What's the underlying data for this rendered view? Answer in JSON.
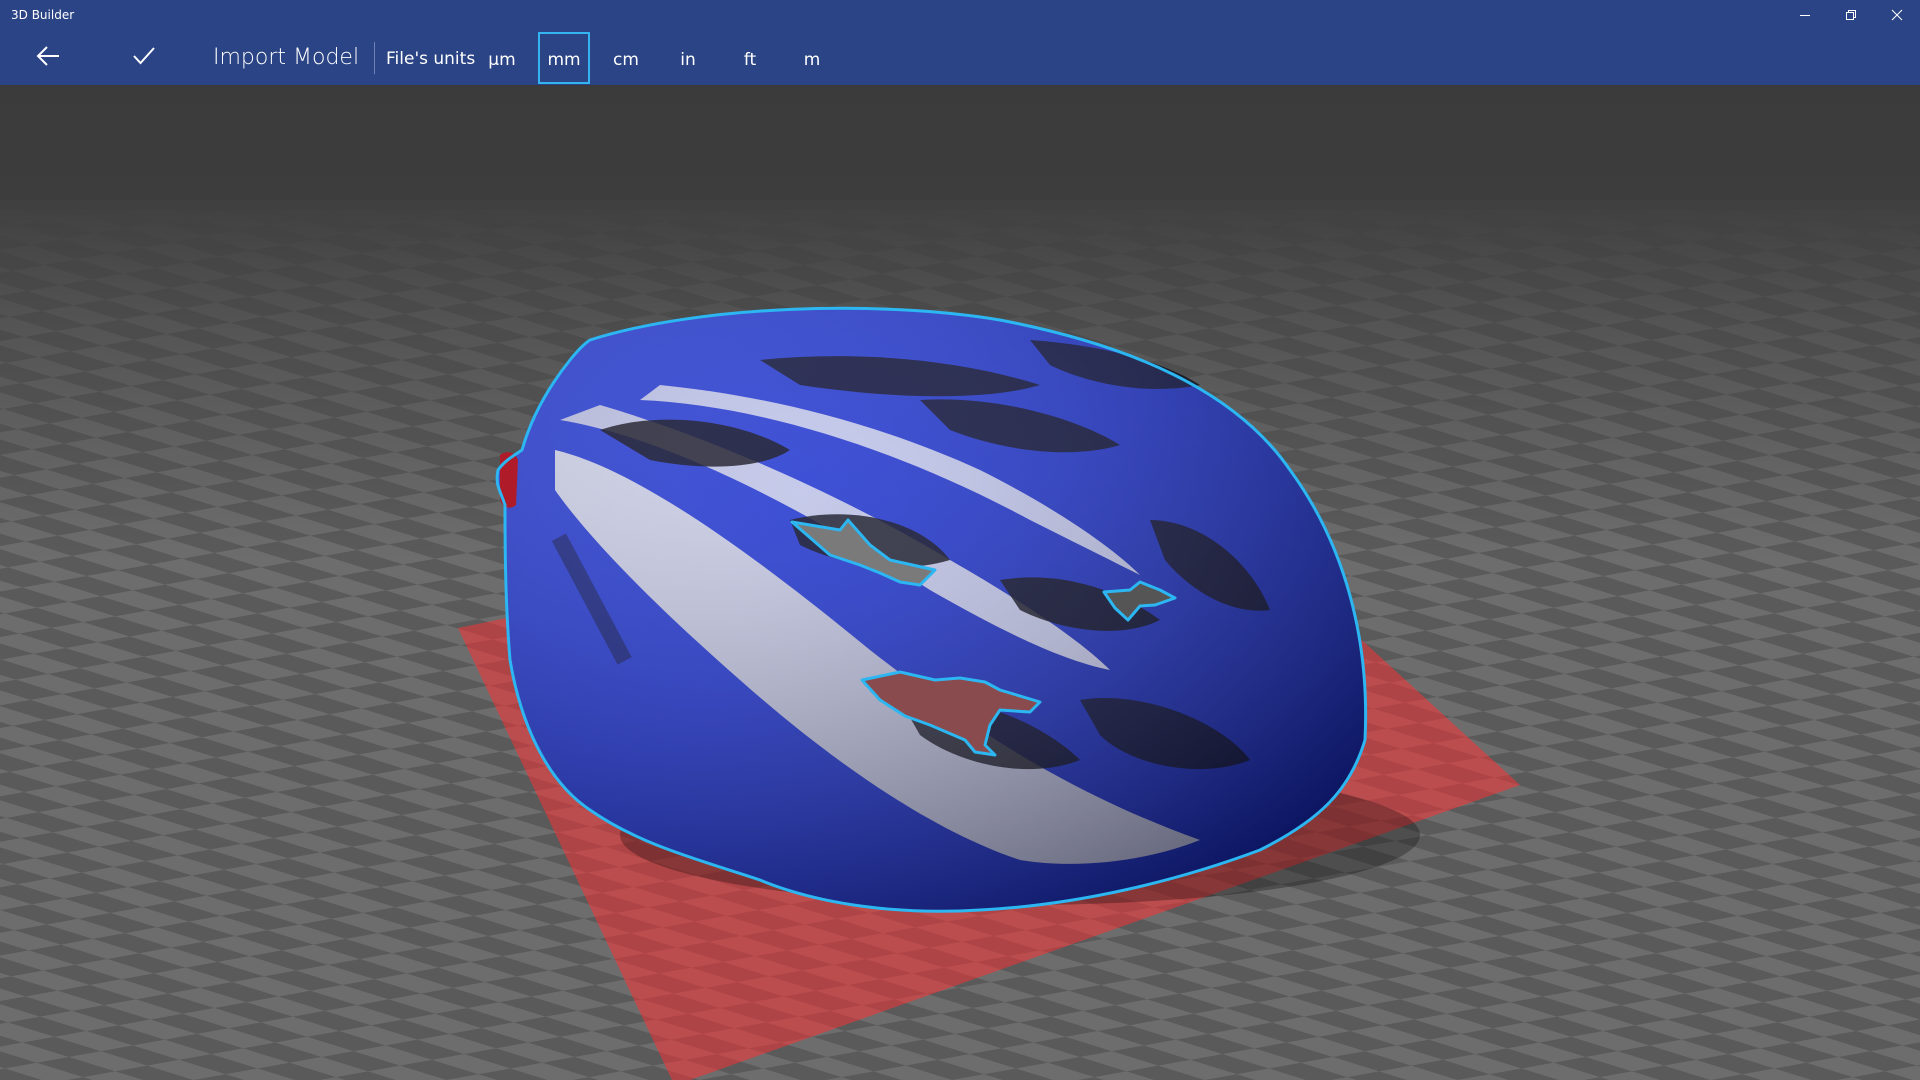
{
  "window": {
    "title": "3D Builder"
  },
  "commandbar": {
    "page_title": "Import Model",
    "units_label": "File's units",
    "units": [
      {
        "label": "µm",
        "selected": false
      },
      {
        "label": "mm",
        "selected": true
      },
      {
        "label": "cm",
        "selected": false
      },
      {
        "label": "in",
        "selected": false
      },
      {
        "label": "ft",
        "selected": false
      },
      {
        "label": "m",
        "selected": false
      }
    ],
    "selected_unit": "mm"
  },
  "icons": {
    "back": "back-arrow-icon",
    "confirm": "checkmark-icon",
    "minimize": "minimize-icon",
    "restore": "restore-icon",
    "close": "close-icon"
  },
  "colors": {
    "titlebar": "#2b4485",
    "selection_outline": "#2cb6f2",
    "selected_unit_border": "#34b4f0",
    "floor_light": "#6d6d6d",
    "floor_dark": "#5a5a5a",
    "build_plate": "#c8494b",
    "model_primary": "#1f33c9",
    "model_highlight": "#dcdcdc"
  },
  "scene": {
    "model": "bicycle-helmet",
    "selected": true
  }
}
